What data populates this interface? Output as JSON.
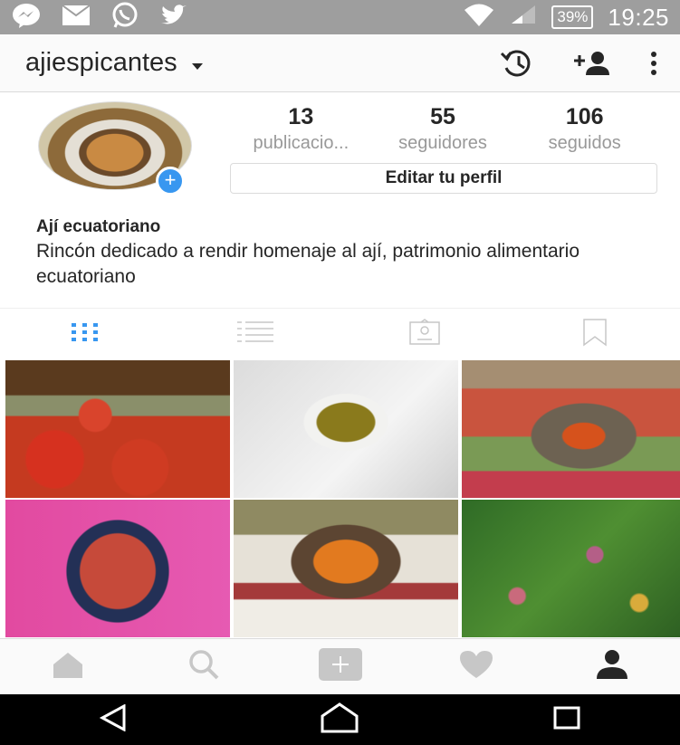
{
  "status_bar": {
    "icons": [
      "messenger-icon",
      "mail-icon",
      "whatsapp-icon",
      "twitter-icon",
      "wifi-icon",
      "signal-icon"
    ],
    "battery": "39%",
    "time": "19:25"
  },
  "header": {
    "username": "ajiespicantes",
    "icons": [
      "history-icon",
      "add-person-icon",
      "more-vert-icon"
    ]
  },
  "profile": {
    "stats": [
      {
        "value": "13",
        "label": "publicacio..."
      },
      {
        "value": "55",
        "label": "seguidores"
      },
      {
        "value": "106",
        "label": "seguidos"
      }
    ],
    "edit_button": "Editar tu perfil",
    "bio_name": "Ají ecuatoriano",
    "bio_text": "Rincón dedicado a rendir homenaje al ají, patrimonio alimentario ecuatoriano"
  },
  "tabs": [
    "grid-icon",
    "list-icon",
    "tagged-icon",
    "saved-icon"
  ],
  "active_tab": "grid-icon",
  "posts_count": 6,
  "bottom_nav": [
    "home-icon",
    "search-icon",
    "add-icon",
    "heart-icon",
    "profile-icon"
  ],
  "android_nav": [
    "back-icon",
    "home-icon",
    "recents-icon"
  ],
  "colors": {
    "accent": "#3897f0",
    "status_bar": "#9e9e9e",
    "muted": "#999999"
  }
}
